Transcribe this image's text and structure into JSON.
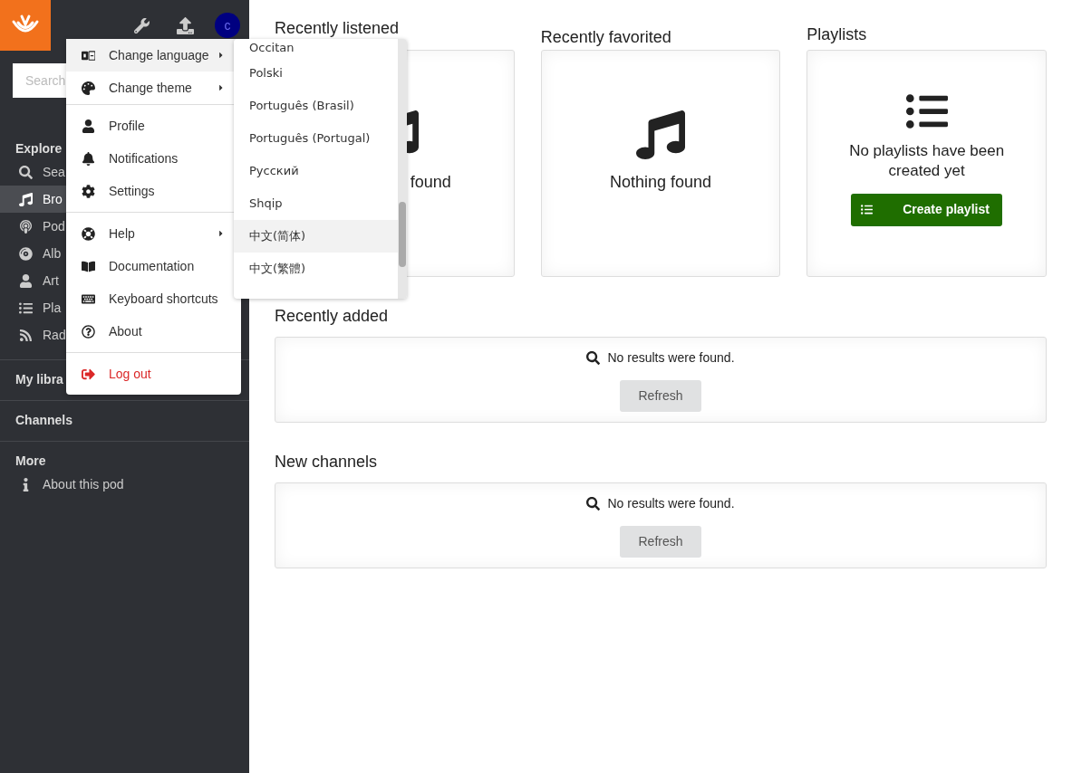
{
  "sidebar": {
    "avatar": {
      "initial": "c"
    },
    "search": {
      "placeholder": "Search"
    },
    "sections": [
      {
        "title": "Explore",
        "items": [
          {
            "label": "Sea",
            "selected": false
          },
          {
            "label": "Bro",
            "selected": true
          },
          {
            "label": "Pod",
            "selected": false
          },
          {
            "label": "Alb",
            "selected": false
          },
          {
            "label": "Art",
            "selected": false
          },
          {
            "label": "Pla",
            "selected": false
          },
          {
            "label": "Rad",
            "selected": false
          }
        ]
      },
      {
        "title": "My libra"
      },
      {
        "title": "Channels"
      },
      {
        "title": "More",
        "items": [
          {
            "label": "About this pod",
            "selected": false
          }
        ]
      }
    ]
  },
  "user_menu": {
    "groups": [
      [
        {
          "label": "Change language",
          "has_submenu": true,
          "selected": true,
          "kind": "normal"
        },
        {
          "label": "Change theme",
          "has_submenu": true,
          "selected": false,
          "kind": "normal"
        }
      ],
      [
        {
          "label": "Profile",
          "has_submenu": false,
          "selected": false,
          "kind": "normal"
        },
        {
          "label": "Notifications",
          "has_submenu": false,
          "selected": false,
          "kind": "normal"
        },
        {
          "label": "Settings",
          "has_submenu": false,
          "selected": false,
          "kind": "normal"
        }
      ],
      [
        {
          "label": "Help",
          "has_submenu": true,
          "selected": false,
          "kind": "normal"
        },
        {
          "label": "Documentation",
          "has_submenu": false,
          "selected": false,
          "kind": "normal"
        },
        {
          "label": "Keyboard shortcuts",
          "has_submenu": false,
          "selected": false,
          "kind": "normal"
        },
        {
          "label": "About",
          "has_submenu": false,
          "selected": false,
          "kind": "normal"
        }
      ],
      [
        {
          "label": "Log out",
          "has_submenu": false,
          "selected": false,
          "kind": "danger"
        }
      ]
    ]
  },
  "language_menu": {
    "items": [
      {
        "label": "Occitan",
        "selected": false
      },
      {
        "label": "Polski",
        "selected": false
      },
      {
        "label": "Português (Brasil)",
        "selected": false
      },
      {
        "label": "Português (Portugal)",
        "selected": false
      },
      {
        "label": "Русский",
        "selected": false
      },
      {
        "label": "Shqip",
        "selected": false
      },
      {
        "label": "中文(简体)",
        "selected": true
      },
      {
        "label": "中文(繁體)",
        "selected": false
      }
    ]
  },
  "cards": [
    {
      "kind": "empty",
      "title": "Recently listened",
      "message": "found"
    },
    {
      "kind": "empty",
      "title": "Recently favorited",
      "message": "Nothing found"
    },
    {
      "kind": "playlist",
      "title": "Playlists",
      "message": "No playlists have been created yet",
      "button": "Create playlist"
    }
  ],
  "widgets": [
    {
      "title": "Recently added",
      "message": "No results were found.",
      "button": "Refresh"
    },
    {
      "title": "New channels",
      "message": "No results were found.",
      "button": "Refresh"
    }
  ]
}
